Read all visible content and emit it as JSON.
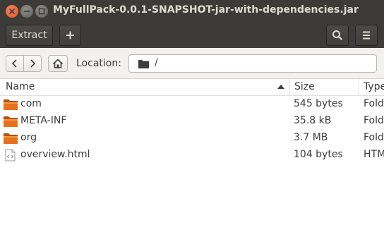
{
  "window": {
    "title": "MyFullPack-0.0.1-SNAPSHOT-jar-with-dependencies.jar",
    "controls": [
      "close-icon",
      "minimize-icon",
      "maximize-icon"
    ]
  },
  "toolbar": {
    "extract_label": "Extract",
    "add_icon": "plus-icon",
    "search_icon": "search-icon",
    "menu_icon": "hamburger-menu-icon"
  },
  "location": {
    "label": "Location:",
    "path": "/",
    "back_icon": "chevron-left-icon",
    "forward_icon": "chevron-right-icon",
    "home_icon": "home-icon"
  },
  "columns": {
    "name": "Name",
    "size": "Size",
    "type": "Type",
    "sort": "ascending"
  },
  "files": [
    {
      "name": "com",
      "size": "545 bytes",
      "type": "Folder",
      "icon": "folder-icon"
    },
    {
      "name": "META-INF",
      "size": "35.8 kB",
      "type": "Folder",
      "icon": "folder-icon"
    },
    {
      "name": "org",
      "size": "3.7 MB",
      "type": "Folder",
      "icon": "folder-icon"
    },
    {
      "name": "overview.html",
      "size": "104 bytes",
      "type": "HTML",
      "icon": "html-file-icon"
    }
  ],
  "colors": {
    "titlebar": "#3c3b37",
    "close_button": "#e95420",
    "folder": "#e8711d"
  }
}
